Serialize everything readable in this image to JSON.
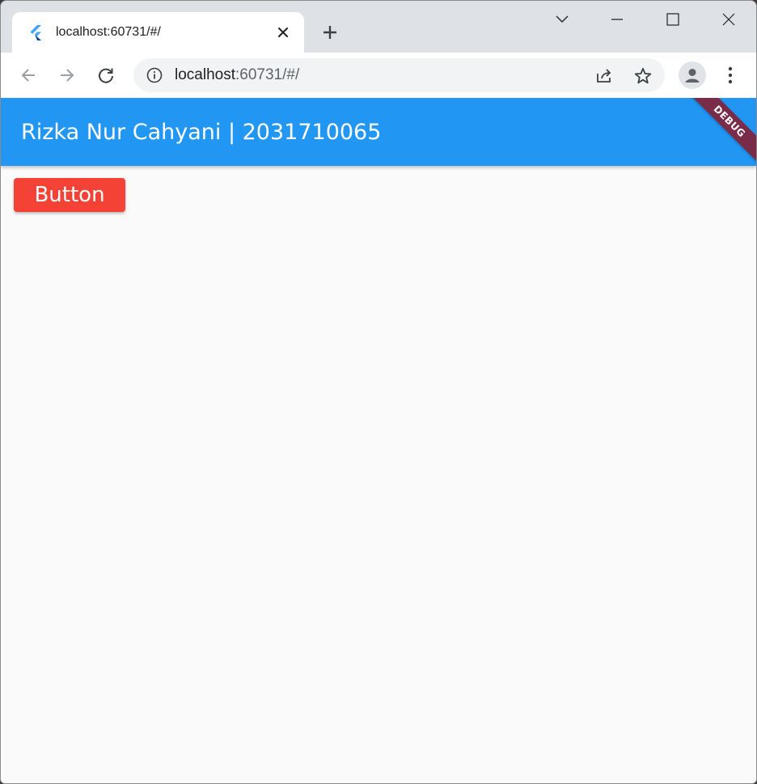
{
  "browser": {
    "tab": {
      "title": "localhost:60731/#/",
      "favicon": "flutter-icon"
    },
    "new_tab_icon": "plus-icon",
    "window_controls": [
      "chevron-down-icon",
      "minimize-icon",
      "maximize-icon",
      "close-icon"
    ],
    "address": {
      "host": "localhost",
      "path": ":60731/#/"
    },
    "colors": {
      "tabstrip": "#dee1e6",
      "omnibox": "#f1f3f4"
    }
  },
  "app": {
    "title": "Rizka Nur Cahyani | 2031710065",
    "debug_banner": "DEBUG",
    "button_label": "Button",
    "colors": {
      "appbar": "#2196f3",
      "button": "#f44336",
      "debug_banner": "#7a2b48",
      "background": "#fafafa"
    }
  }
}
